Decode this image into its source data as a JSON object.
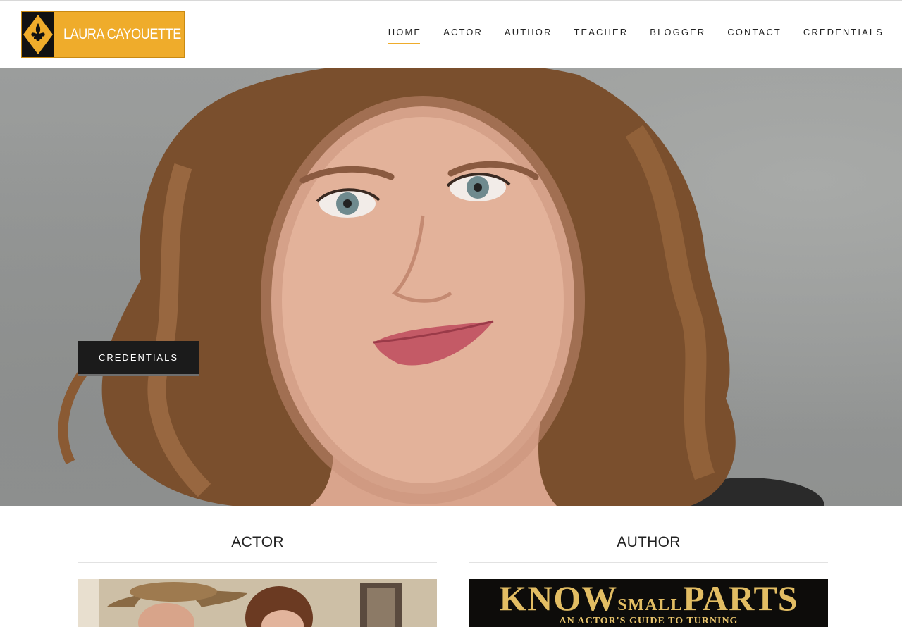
{
  "site": {
    "logo_text": "LAURA CAYOUETTE",
    "logo_icon": "fleur-de-lis-icon",
    "accent_color": "#efac2b"
  },
  "nav": {
    "items": [
      {
        "label": "HOME",
        "active": true
      },
      {
        "label": "ACTOR",
        "active": false
      },
      {
        "label": "AUTHOR",
        "active": false
      },
      {
        "label": "TEACHER",
        "active": false
      },
      {
        "label": "BLOGGER",
        "active": false
      },
      {
        "label": "CONTACT",
        "active": false
      },
      {
        "label": "CREDENTIALS",
        "active": false
      }
    ]
  },
  "hero": {
    "button_label": "CREDENTIALS"
  },
  "cards": [
    {
      "title": "ACTOR"
    },
    {
      "title": "AUTHOR",
      "book_title_part1": "KNOW",
      "book_title_part2": "SMALL",
      "book_title_part3": "PARTS",
      "book_subtitle": "AN ACTOR'S GUIDE TO TURNING"
    }
  ]
}
